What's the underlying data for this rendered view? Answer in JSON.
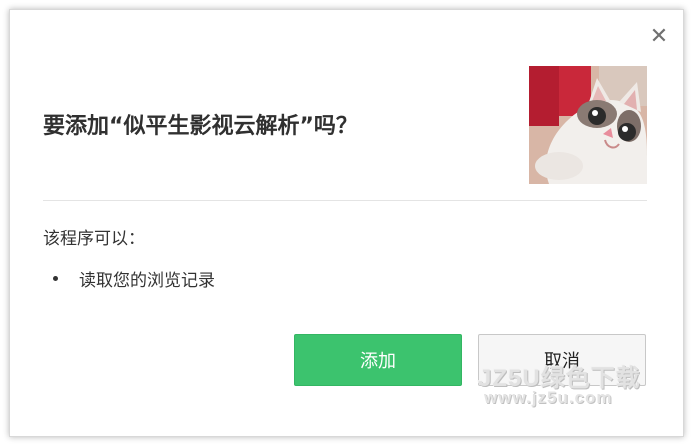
{
  "dialog": {
    "close_glyph": "✕",
    "title": "要添加“似平生影视云解析”吗？",
    "extension_image": "cat-photo",
    "permissions_heading": "该程序可以：",
    "permissions": [
      {
        "label": "读取您的浏览记录"
      }
    ],
    "buttons": {
      "add_label": "添加",
      "cancel_label": "取消"
    },
    "colors": {
      "add_button": "#3cc36e",
      "cancel_button": "#f6f6f6",
      "divider": "#e4e4e4"
    }
  },
  "watermark": {
    "line1": "JZ5U绿色下载",
    "line2": "www.jz5u.com"
  }
}
